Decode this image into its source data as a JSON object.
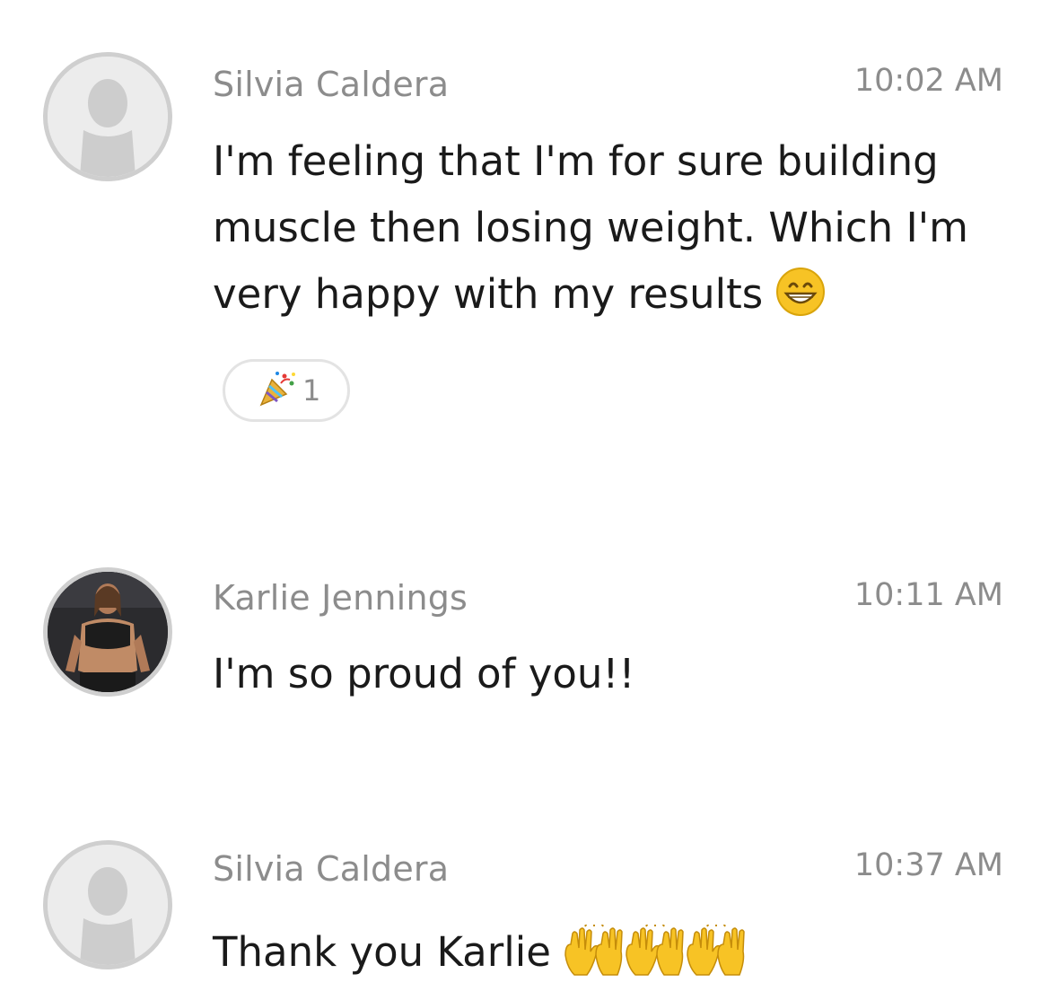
{
  "messages": [
    {
      "sender": "Silvia Caldera",
      "time": "10:02 AM",
      "lines": [
        "I'm feeling that I'm for sure building",
        "muscle then losing weight. Which I'm",
        "very happy with my results"
      ],
      "emoji": "grinning-face-with-smiling-eyes",
      "reaction": {
        "emoji": "party-popper",
        "count": "1"
      }
    },
    {
      "sender": "Karlie Jennings",
      "time": "10:11 AM",
      "lines": [
        "I'm so proud of you!!"
      ]
    },
    {
      "sender": "Silvia Caldera",
      "time": "10:37 AM",
      "lines": [
        "Thank you Karlie"
      ],
      "emoji": "raising-hands x3"
    }
  ],
  "colors": {
    "name": "#8c8c8c",
    "text": "#1a1a1a",
    "avatar_border": "#cfcfcf",
    "emoji_yellow": "#f7c325"
  }
}
